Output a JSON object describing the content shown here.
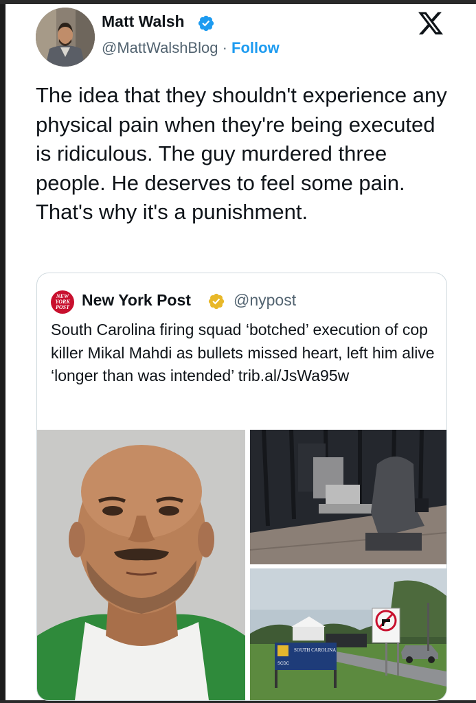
{
  "author": {
    "name": "Matt Walsh",
    "handle": "@MattWalshBlog",
    "separator": "·",
    "follow_label": "Follow"
  },
  "post": {
    "text": "The idea that they shouldn't experience any physical pain when they're being executed is ridiculous. The guy murdered three people. He deserves to feel some pain. That's why it's a punishment."
  },
  "quoted": {
    "name": "New York Post",
    "handle": "@nypost",
    "logo_text": "NEW YORK POST",
    "text": "South Carolina firing squad ‘botched’ execution of cop killer Mikal Mahdi as bullets missed heart, left him alive ‘longer than was intended’ trib.al/JsWa95w"
  },
  "sign": {
    "line1": "SOUTH CAROLINA",
    "scdc": "SCDC"
  },
  "colors": {
    "accent": "#1d9bf0",
    "verified_gold": "#e8b829",
    "nyp_red": "#c8102e"
  },
  "icons": {
    "brand": "x-logo-icon",
    "verified": "verified-badge-icon",
    "org_verified": "gold-verified-badge-icon"
  }
}
